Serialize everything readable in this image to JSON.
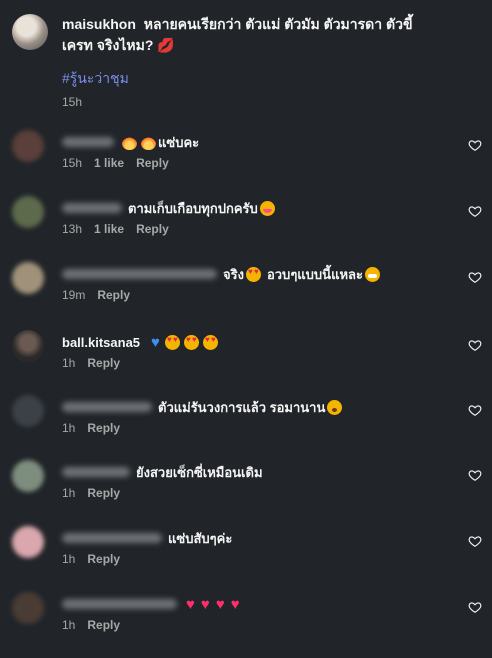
{
  "caption": {
    "username": "maisukhon",
    "text": "หลายคนเรียกว่า ตัวแม่ ตัวมัม ตัวมารดา ตัวขี้เครท จริงไหม?",
    "hashtag": "#รู้นะว่าชุม",
    "time": "15h"
  },
  "comments": [
    {
      "text": "แซ่บคะ",
      "time": "15h",
      "likes": "1 like",
      "reply": "Reply"
    },
    {
      "text": "ตามเก็บเกือบทุกปกครับ",
      "time": "13h",
      "likes": "1 like",
      "reply": "Reply"
    },
    {
      "text": "จริง",
      "text2": "อวบๆแบบนี้แหละ",
      "time": "19m",
      "reply": "Reply"
    },
    {
      "username": "ball.kitsana5",
      "time": "1h",
      "reply": "Reply"
    },
    {
      "text": "ตัวแม่รันวงการแล้ว รอมานาน",
      "time": "1h",
      "reply": "Reply"
    },
    {
      "text": "ยังสวยเซ็กซี่เหมือนเดิม",
      "time": "1h",
      "reply": "Reply"
    },
    {
      "text": "แซ่บสับๆค่ะ",
      "time": "1h",
      "reply": "Reply"
    },
    {
      "text": "",
      "time": "1h",
      "reply": "Reply"
    }
  ],
  "icons": {
    "like": "heart-outline-icon"
  },
  "colors": {
    "background": "#212529",
    "hashtag": "#7a8fe8",
    "meta": "#a8a8a8"
  }
}
